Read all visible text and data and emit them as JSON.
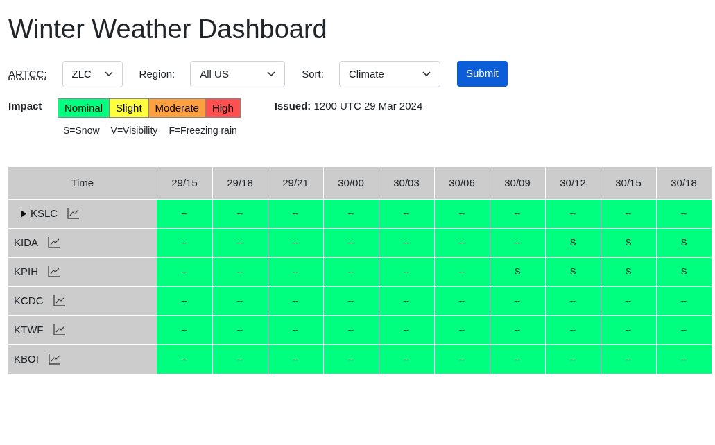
{
  "title": "Winter Weather Dashboard",
  "filters": [
    {
      "label": "ARTCC:",
      "value": "ZLC",
      "abbreviation": true
    },
    {
      "label": "Region:",
      "value": "All US",
      "abbreviation": false
    },
    {
      "label": "Sort:",
      "value": "Climate",
      "abbreviation": false
    }
  ],
  "submit_button": "Submit",
  "impact_legend": {
    "label": "Impact",
    "items": [
      {
        "label": "Nominal",
        "color": "#00ff7f"
      },
      {
        "label": "Slight",
        "color": "#ffff40"
      },
      {
        "label": "Moderate",
        "color": "#ffa040"
      },
      {
        "label": "High",
        "color": "#ff4f4f"
      }
    ]
  },
  "issued": {
    "label": "Issued:",
    "value": "1200 UTC 29 Mar 2024"
  },
  "codes": [
    "S=Snow",
    "V=Visibility",
    "F=Freezing rain"
  ],
  "table": {
    "row_header": "Time",
    "columns": [
      "29/15",
      "29/18",
      "29/21",
      "30/00",
      "30/03",
      "30/06",
      "30/09",
      "30/12",
      "30/15",
      "30/18"
    ],
    "rows": [
      {
        "station": "KSLC",
        "expandable": true,
        "cells": [
          {
            "text": "--",
            "color": "#00ff7f"
          },
          {
            "text": "--",
            "color": "#00ff7f"
          },
          {
            "text": "--",
            "color": "#00ff7f"
          },
          {
            "text": "--",
            "color": "#00ff7f"
          },
          {
            "text": "--",
            "color": "#00ff7f"
          },
          {
            "text": "--",
            "color": "#00ff7f"
          },
          {
            "text": "--",
            "color": "#00ff7f"
          },
          {
            "text": "--",
            "color": "#00ff7f"
          },
          {
            "text": "--",
            "color": "#00ff7f"
          },
          {
            "text": "--",
            "color": "#00ff7f"
          }
        ]
      },
      {
        "station": "KIDA",
        "expandable": false,
        "cells": [
          {
            "text": "--",
            "color": "#00ff7f"
          },
          {
            "text": "--",
            "color": "#00ff7f"
          },
          {
            "text": "--",
            "color": "#00ff7f"
          },
          {
            "text": "--",
            "color": "#00ff7f"
          },
          {
            "text": "--",
            "color": "#00ff7f"
          },
          {
            "text": "--",
            "color": "#00ff7f"
          },
          {
            "text": "--",
            "color": "#00ff7f"
          },
          {
            "text": "S",
            "color": "#00ff7f"
          },
          {
            "text": "S",
            "color": "#00ff7f"
          },
          {
            "text": "S",
            "color": "#00ff7f"
          }
        ]
      },
      {
        "station": "KPIH",
        "expandable": false,
        "cells": [
          {
            "text": "--",
            "color": "#00ff7f"
          },
          {
            "text": "--",
            "color": "#00ff7f"
          },
          {
            "text": "--",
            "color": "#00ff7f"
          },
          {
            "text": "--",
            "color": "#00ff7f"
          },
          {
            "text": "--",
            "color": "#00ff7f"
          },
          {
            "text": "--",
            "color": "#00ff7f"
          },
          {
            "text": "S",
            "color": "#00ff7f"
          },
          {
            "text": "S",
            "color": "#00ff7f"
          },
          {
            "text": "S",
            "color": "#00ff7f"
          },
          {
            "text": "S",
            "color": "#00ff7f"
          }
        ]
      },
      {
        "station": "KCDC",
        "expandable": false,
        "cells": [
          {
            "text": "--",
            "color": "#00ff7f"
          },
          {
            "text": "--",
            "color": "#00ff7f"
          },
          {
            "text": "--",
            "color": "#00ff7f"
          },
          {
            "text": "--",
            "color": "#00ff7f"
          },
          {
            "text": "--",
            "color": "#00ff7f"
          },
          {
            "text": "--",
            "color": "#00ff7f"
          },
          {
            "text": "--",
            "color": "#00ff7f"
          },
          {
            "text": "--",
            "color": "#00ff7f"
          },
          {
            "text": "--",
            "color": "#00ff7f"
          },
          {
            "text": "--",
            "color": "#00ff7f"
          }
        ]
      },
      {
        "station": "KTWF",
        "expandable": false,
        "cells": [
          {
            "text": "--",
            "color": "#00ff7f"
          },
          {
            "text": "--",
            "color": "#00ff7f"
          },
          {
            "text": "--",
            "color": "#00ff7f"
          },
          {
            "text": "--",
            "color": "#00ff7f"
          },
          {
            "text": "--",
            "color": "#00ff7f"
          },
          {
            "text": "--",
            "color": "#00ff7f"
          },
          {
            "text": "--",
            "color": "#00ff7f"
          },
          {
            "text": "--",
            "color": "#00ff7f"
          },
          {
            "text": "--",
            "color": "#00ff7f"
          },
          {
            "text": "--",
            "color": "#00ff7f"
          }
        ]
      },
      {
        "station": "KBOI",
        "expandable": false,
        "cells": [
          {
            "text": "--",
            "color": "#00ff7f"
          },
          {
            "text": "--",
            "color": "#00ff7f"
          },
          {
            "text": "--",
            "color": "#00ff7f"
          },
          {
            "text": "--",
            "color": "#00ff7f"
          },
          {
            "text": "--",
            "color": "#00ff7f"
          },
          {
            "text": "--",
            "color": "#00ff7f"
          },
          {
            "text": "--",
            "color": "#00ff7f"
          },
          {
            "text": "--",
            "color": "#00ff7f"
          },
          {
            "text": "--",
            "color": "#00ff7f"
          },
          {
            "text": "--",
            "color": "#00ff7f"
          }
        ]
      }
    ]
  }
}
